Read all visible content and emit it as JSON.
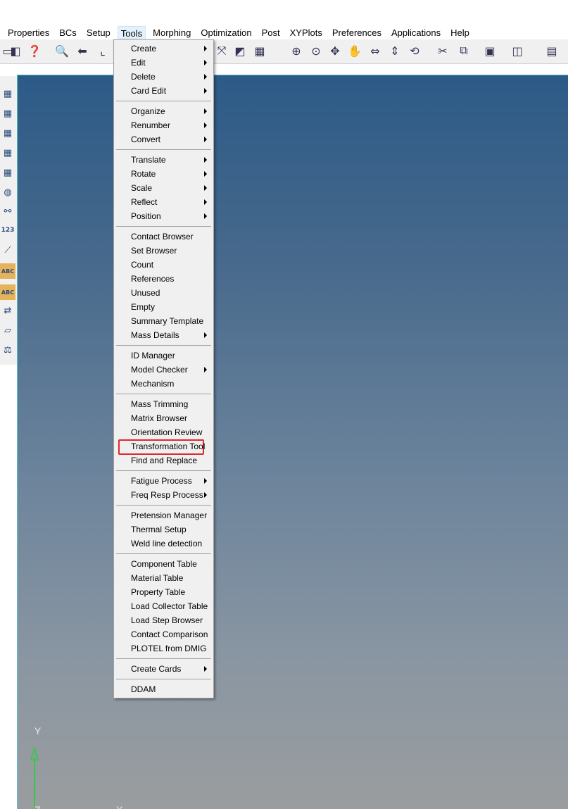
{
  "menubar": {
    "items": [
      "Properties",
      "BCs",
      "Setup",
      "Tools",
      "Morphing",
      "Optimization",
      "Post",
      "XYPlots",
      "Preferences",
      "Applications",
      "Help"
    ],
    "active": "Tools"
  },
  "tools_menu": {
    "items": [
      {
        "label": "Create",
        "submenu": true
      },
      {
        "label": "Edit",
        "submenu": true
      },
      {
        "label": "Delete",
        "submenu": true
      },
      {
        "label": "Card Edit",
        "submenu": true
      },
      {
        "label": "Organize",
        "submenu": true
      },
      {
        "label": "Renumber",
        "submenu": true
      },
      {
        "label": "Convert",
        "submenu": true
      },
      {
        "label": "Translate",
        "submenu": true
      },
      {
        "label": "Rotate",
        "submenu": true
      },
      {
        "label": "Scale",
        "submenu": true
      },
      {
        "label": "Reflect",
        "submenu": true
      },
      {
        "label": "Position",
        "submenu": true
      },
      {
        "label": "Contact Browser",
        "submenu": false
      },
      {
        "label": "Set Browser",
        "submenu": false
      },
      {
        "label": "Count",
        "submenu": false
      },
      {
        "label": "References",
        "submenu": false
      },
      {
        "label": "Unused",
        "submenu": false
      },
      {
        "label": "Empty",
        "submenu": false
      },
      {
        "label": "Summary Template",
        "submenu": false
      },
      {
        "label": "Mass Details",
        "submenu": true
      },
      {
        "label": "ID Manager",
        "submenu": false
      },
      {
        "label": "Model Checker",
        "submenu": true
      },
      {
        "label": "Mechanism",
        "submenu": false
      },
      {
        "label": "Mass Trimming",
        "submenu": false
      },
      {
        "label": "Matrix Browser",
        "submenu": false
      },
      {
        "label": "Orientation Review",
        "submenu": false
      },
      {
        "label": "Transformation Tool",
        "submenu": false,
        "highlighted": true
      },
      {
        "label": "Find and Replace",
        "submenu": false
      },
      {
        "label": "Fatigue Process",
        "submenu": true
      },
      {
        "label": "Freq Resp Process",
        "submenu": true
      },
      {
        "label": "Pretension Manager",
        "submenu": false
      },
      {
        "label": "Thermal Setup",
        "submenu": false
      },
      {
        "label": "Weld line detection",
        "submenu": false
      },
      {
        "label": "Component Table",
        "submenu": false
      },
      {
        "label": "Material Table",
        "submenu": false
      },
      {
        "label": "Property Table",
        "submenu": false
      },
      {
        "label": "Load Collector Table",
        "submenu": false
      },
      {
        "label": "Load Step Browser",
        "submenu": false
      },
      {
        "label": "Contact Comparison",
        "submenu": false
      },
      {
        "label": "PLOTEL from DMIG",
        "submenu": false
      },
      {
        "label": "Create Cards",
        "submenu": true
      },
      {
        "label": "DDAM",
        "submenu": false
      }
    ],
    "groups": [
      4,
      3,
      5,
      8,
      3,
      5,
      2,
      3,
      7,
      1,
      1
    ]
  },
  "axes": {
    "y": "Y",
    "z": "Z",
    "x": "X"
  },
  "colors": {
    "highlight_box": "#e0262d",
    "viewport_top": "#2c5a87",
    "viewport_bottom": "#9a9d9f",
    "viewport_border": "#59c5cf"
  },
  "left_strip": {
    "count_label": "123",
    "abc_label": "ABC"
  }
}
